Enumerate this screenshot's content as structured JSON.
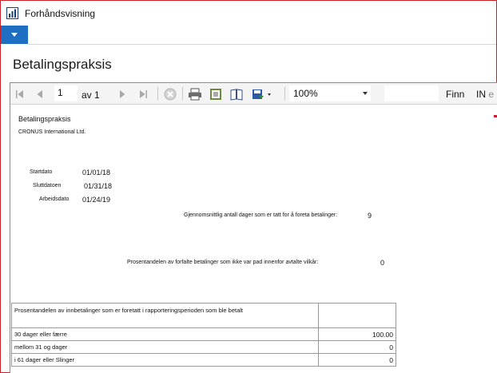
{
  "window": {
    "title": "Forhåndsvisning",
    "icon": "report-chart-icon",
    "accent_color": "#1e6fc2"
  },
  "page": {
    "title": "Betalingspraksis"
  },
  "toolbar": {
    "current_page": "1",
    "of_label": "av 1",
    "zoom": "100%",
    "find_label": "Finn",
    "next_label_visible": "IN",
    "next_label_faded": "e",
    "icons": [
      "first-page-icon",
      "previous-page-icon",
      "next-page-icon",
      "last-page-icon",
      "stop-icon",
      "print-icon",
      "page-setup-icon",
      "print-layout-icon",
      "export-icon"
    ]
  },
  "report": {
    "title": "Betalingspraksis",
    "company": "CRONUS International Ltd.",
    "start_label": "Startdato",
    "start_value": "01/01/18",
    "end_label": "Sluttdatoen",
    "end_value": "01/31/18",
    "work_label": "Arbeidsdato",
    "work_value": "01/24/19",
    "avg_days_label": "Gjennomsnittlig antall dager som er tatt for å foreta betalinger:",
    "avg_days_value": "9",
    "pct_overdue_label": "Prosentandelen av forfalte betalinger som ikke var pad innenfor avtalte vilkår:",
    "pct_overdue_value": "0",
    "table": {
      "header": "Prosentandelen av innbetalinger som er foretatt i rapporteringsperioden som ble betalt",
      "rows": [
        {
          "label": "30 dager eller færre",
          "value": "100.00"
        },
        {
          "label": "mellom 31 og dager",
          "value": "0"
        },
        {
          "label": "i 61 dager eller Slinger",
          "value": "0"
        }
      ]
    }
  }
}
